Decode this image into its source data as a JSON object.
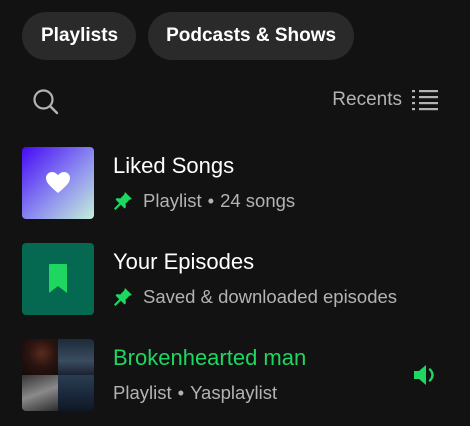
{
  "filters": {
    "playlists": "Playlists",
    "podcasts_shows": "Podcasts & Shows"
  },
  "toolbar": {
    "sort_label": "Recents"
  },
  "library": [
    {
      "title": "Liked Songs",
      "type": "Playlist",
      "detail": "24 songs",
      "pinned": true,
      "art_icon": "heart-icon"
    },
    {
      "title": "Your Episodes",
      "detail": "Saved & downloaded episodes",
      "pinned": true,
      "art_icon": "bookmark-icon"
    },
    {
      "title": "Brokenhearted man",
      "type": "Playlist",
      "owner": "Yasplaylist",
      "pinned": false,
      "now_playing": true
    }
  ],
  "colors": {
    "background": "#121212",
    "chip": "#2a2a2a",
    "accent": "#1ed760",
    "secondary_text": "#b3b3b3",
    "episodes_art": "#056952"
  }
}
